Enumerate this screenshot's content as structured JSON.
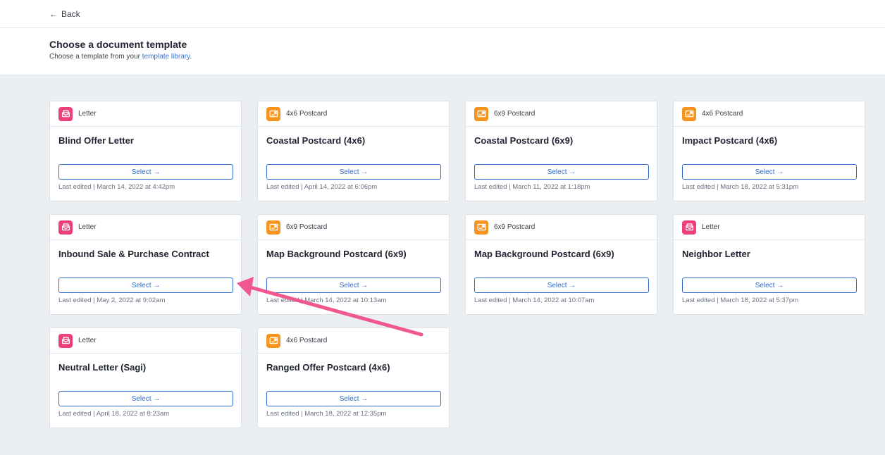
{
  "nav": {
    "back_label": "Back"
  },
  "header": {
    "title": "Choose a document template",
    "subtitle_prefix": "Choose a template from your ",
    "subtitle_link": "template library",
    "subtitle_suffix": "."
  },
  "colors": {
    "letter_icon": "#ee3f7c",
    "postcard_icon": "#f7941d",
    "accent": "#2f6bc9",
    "annotation_arrow": "#f0588f"
  },
  "templates": [
    {
      "type": "Letter",
      "icon": "letter-icon",
      "title": "Blind Offer Letter",
      "select_label": "Select →",
      "edited": "Last edited | March 14, 2022 at 4:42pm"
    },
    {
      "type": "4x6 Postcard",
      "icon": "postcard-icon",
      "title": "Coastal Postcard (4x6)",
      "select_label": "Select →",
      "edited": "Last edited | April 14, 2022 at 6:06pm"
    },
    {
      "type": "6x9 Postcard",
      "icon": "postcard-icon",
      "title": "Coastal Postcard (6x9)",
      "select_label": "Select →",
      "edited": "Last edited | March 11, 2022 at 1:18pm"
    },
    {
      "type": "4x6 Postcard",
      "icon": "postcard-icon",
      "title": "Impact Postcard (4x6)",
      "select_label": "Select →",
      "edited": "Last edited | March 18, 2022 at 5:31pm"
    },
    {
      "type": "Letter",
      "icon": "letter-icon",
      "title": "Inbound Sale & Purchase Contract",
      "select_label": "Select →",
      "edited": "Last edited | May 2, 2022 at 9:02am"
    },
    {
      "type": "6x9 Postcard",
      "icon": "postcard-icon",
      "title": "Map Background Postcard (6x9)",
      "select_label": "Select →",
      "edited": "Last edited | March 14, 2022 at 10:13am"
    },
    {
      "type": "6x9 Postcard",
      "icon": "postcard-icon",
      "title": "Map Background Postcard (6x9)",
      "select_label": "Select →",
      "edited": "Last edited | March 14, 2022 at 10:07am"
    },
    {
      "type": "Letter",
      "icon": "letter-icon",
      "title": "Neighbor Letter",
      "select_label": "Select →",
      "edited": "Last edited | March 18, 2022 at 5:37pm"
    },
    {
      "type": "Letter",
      "icon": "letter-icon",
      "title": "Neutral Letter (Sagi)",
      "select_label": "Select →",
      "edited": "Last edited | April 18, 2022 at 8:23am"
    },
    {
      "type": "4x6 Postcard",
      "icon": "postcard-icon",
      "title": "Ranged Offer Postcard (4x6)",
      "select_label": "Select →",
      "edited": "Last edited | March 18, 2022 at 12:35pm"
    }
  ]
}
